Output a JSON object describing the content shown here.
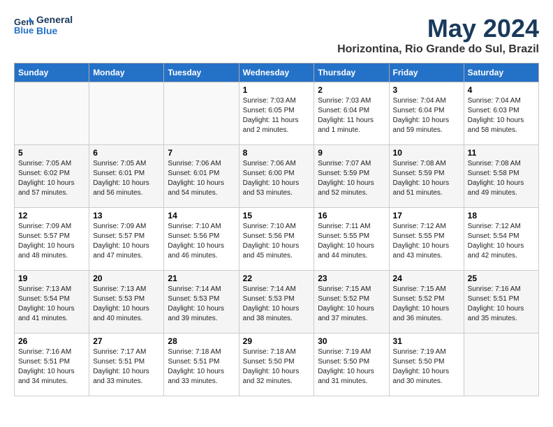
{
  "logo": {
    "line1": "General",
    "line2": "Blue"
  },
  "title": "May 2024",
  "location": "Horizontina, Rio Grande do Sul, Brazil",
  "headers": [
    "Sunday",
    "Monday",
    "Tuesday",
    "Wednesday",
    "Thursday",
    "Friday",
    "Saturday"
  ],
  "weeks": [
    [
      {
        "num": "",
        "sunrise": "",
        "sunset": "",
        "daylight": ""
      },
      {
        "num": "",
        "sunrise": "",
        "sunset": "",
        "daylight": ""
      },
      {
        "num": "",
        "sunrise": "",
        "sunset": "",
        "daylight": ""
      },
      {
        "num": "1",
        "sunrise": "Sunrise: 7:03 AM",
        "sunset": "Sunset: 6:05 PM",
        "daylight": "Daylight: 11 hours and 2 minutes."
      },
      {
        "num": "2",
        "sunrise": "Sunrise: 7:03 AM",
        "sunset": "Sunset: 6:04 PM",
        "daylight": "Daylight: 11 hours and 1 minute."
      },
      {
        "num": "3",
        "sunrise": "Sunrise: 7:04 AM",
        "sunset": "Sunset: 6:04 PM",
        "daylight": "Daylight: 10 hours and 59 minutes."
      },
      {
        "num": "4",
        "sunrise": "Sunrise: 7:04 AM",
        "sunset": "Sunset: 6:03 PM",
        "daylight": "Daylight: 10 hours and 58 minutes."
      }
    ],
    [
      {
        "num": "5",
        "sunrise": "Sunrise: 7:05 AM",
        "sunset": "Sunset: 6:02 PM",
        "daylight": "Daylight: 10 hours and 57 minutes."
      },
      {
        "num": "6",
        "sunrise": "Sunrise: 7:05 AM",
        "sunset": "Sunset: 6:01 PM",
        "daylight": "Daylight: 10 hours and 56 minutes."
      },
      {
        "num": "7",
        "sunrise": "Sunrise: 7:06 AM",
        "sunset": "Sunset: 6:01 PM",
        "daylight": "Daylight: 10 hours and 54 minutes."
      },
      {
        "num": "8",
        "sunrise": "Sunrise: 7:06 AM",
        "sunset": "Sunset: 6:00 PM",
        "daylight": "Daylight: 10 hours and 53 minutes."
      },
      {
        "num": "9",
        "sunrise": "Sunrise: 7:07 AM",
        "sunset": "Sunset: 5:59 PM",
        "daylight": "Daylight: 10 hours and 52 minutes."
      },
      {
        "num": "10",
        "sunrise": "Sunrise: 7:08 AM",
        "sunset": "Sunset: 5:59 PM",
        "daylight": "Daylight: 10 hours and 51 minutes."
      },
      {
        "num": "11",
        "sunrise": "Sunrise: 7:08 AM",
        "sunset": "Sunset: 5:58 PM",
        "daylight": "Daylight: 10 hours and 49 minutes."
      }
    ],
    [
      {
        "num": "12",
        "sunrise": "Sunrise: 7:09 AM",
        "sunset": "Sunset: 5:57 PM",
        "daylight": "Daylight: 10 hours and 48 minutes."
      },
      {
        "num": "13",
        "sunrise": "Sunrise: 7:09 AM",
        "sunset": "Sunset: 5:57 PM",
        "daylight": "Daylight: 10 hours and 47 minutes."
      },
      {
        "num": "14",
        "sunrise": "Sunrise: 7:10 AM",
        "sunset": "Sunset: 5:56 PM",
        "daylight": "Daylight: 10 hours and 46 minutes."
      },
      {
        "num": "15",
        "sunrise": "Sunrise: 7:10 AM",
        "sunset": "Sunset: 5:56 PM",
        "daylight": "Daylight: 10 hours and 45 minutes."
      },
      {
        "num": "16",
        "sunrise": "Sunrise: 7:11 AM",
        "sunset": "Sunset: 5:55 PM",
        "daylight": "Daylight: 10 hours and 44 minutes."
      },
      {
        "num": "17",
        "sunrise": "Sunrise: 7:12 AM",
        "sunset": "Sunset: 5:55 PM",
        "daylight": "Daylight: 10 hours and 43 minutes."
      },
      {
        "num": "18",
        "sunrise": "Sunrise: 7:12 AM",
        "sunset": "Sunset: 5:54 PM",
        "daylight": "Daylight: 10 hours and 42 minutes."
      }
    ],
    [
      {
        "num": "19",
        "sunrise": "Sunrise: 7:13 AM",
        "sunset": "Sunset: 5:54 PM",
        "daylight": "Daylight: 10 hours and 41 minutes."
      },
      {
        "num": "20",
        "sunrise": "Sunrise: 7:13 AM",
        "sunset": "Sunset: 5:53 PM",
        "daylight": "Daylight: 10 hours and 40 minutes."
      },
      {
        "num": "21",
        "sunrise": "Sunrise: 7:14 AM",
        "sunset": "Sunset: 5:53 PM",
        "daylight": "Daylight: 10 hours and 39 minutes."
      },
      {
        "num": "22",
        "sunrise": "Sunrise: 7:14 AM",
        "sunset": "Sunset: 5:53 PM",
        "daylight": "Daylight: 10 hours and 38 minutes."
      },
      {
        "num": "23",
        "sunrise": "Sunrise: 7:15 AM",
        "sunset": "Sunset: 5:52 PM",
        "daylight": "Daylight: 10 hours and 37 minutes."
      },
      {
        "num": "24",
        "sunrise": "Sunrise: 7:15 AM",
        "sunset": "Sunset: 5:52 PM",
        "daylight": "Daylight: 10 hours and 36 minutes."
      },
      {
        "num": "25",
        "sunrise": "Sunrise: 7:16 AM",
        "sunset": "Sunset: 5:51 PM",
        "daylight": "Daylight: 10 hours and 35 minutes."
      }
    ],
    [
      {
        "num": "26",
        "sunrise": "Sunrise: 7:16 AM",
        "sunset": "Sunset: 5:51 PM",
        "daylight": "Daylight: 10 hours and 34 minutes."
      },
      {
        "num": "27",
        "sunrise": "Sunrise: 7:17 AM",
        "sunset": "Sunset: 5:51 PM",
        "daylight": "Daylight: 10 hours and 33 minutes."
      },
      {
        "num": "28",
        "sunrise": "Sunrise: 7:18 AM",
        "sunset": "Sunset: 5:51 PM",
        "daylight": "Daylight: 10 hours and 33 minutes."
      },
      {
        "num": "29",
        "sunrise": "Sunrise: 7:18 AM",
        "sunset": "Sunset: 5:50 PM",
        "daylight": "Daylight: 10 hours and 32 minutes."
      },
      {
        "num": "30",
        "sunrise": "Sunrise: 7:19 AM",
        "sunset": "Sunset: 5:50 PM",
        "daylight": "Daylight: 10 hours and 31 minutes."
      },
      {
        "num": "31",
        "sunrise": "Sunrise: 7:19 AM",
        "sunset": "Sunset: 5:50 PM",
        "daylight": "Daylight: 10 hours and 30 minutes."
      },
      {
        "num": "",
        "sunrise": "",
        "sunset": "",
        "daylight": ""
      }
    ]
  ]
}
